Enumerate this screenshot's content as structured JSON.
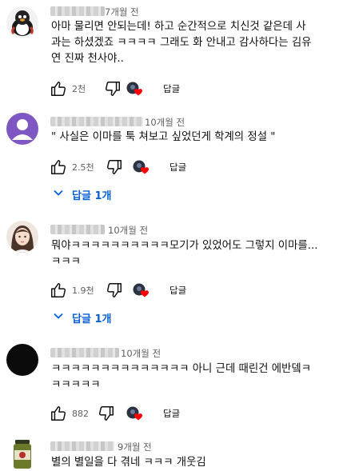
{
  "comments": [
    {
      "time": "7개월 전",
      "lines": [
        "아마 물리면 안되는데! 하고 순간적으로 치신것 같은데 사",
        "과는 하셨겠죠 ㅋㅋㅋㅋ 그래도 화 안내고 감사하다는 김유",
        "연 진짜 천사야.."
      ],
      "likes": "2천",
      "reply_label": "답글"
    },
    {
      "time": "10개월 전",
      "lines": [
        "\" 사실은 이마를 툭 쳐보고 싶었던게 학계의 정설 \""
      ],
      "likes": "2.5천",
      "reply_label": "답글",
      "replies_label": "답글 1개"
    },
    {
      "time": "10개월 전",
      "lines": [
        "뭐야ㅋㅋㅋㅋㅋㅋㅋㅋㅋㅋ모기가 있었어도 그렇지 이마를...",
        "ㅋㅋㅋ"
      ],
      "likes": "1.9천",
      "reply_label": "답글",
      "replies_label": "답글 1개"
    },
    {
      "time": "10개월 전",
      "lines": [
        "ㅋㅋㅋㅋㅋㅋㅋㅋㅋㅋㅋㅋㅋㅋ 아니 근데 때린건 에반뎈ㅋ",
        "ㅋㅋㅋㅋㅋ"
      ],
      "likes": "882",
      "reply_label": "답글"
    },
    {
      "time": "9개월 전",
      "lines": [
        "별의 별일을 다 겪네 ㅋㅋㅋ 개웃김"
      ]
    }
  ],
  "icons": {
    "like": "thumbs-up-icon",
    "dislike": "thumbs-down-icon",
    "creator_heart": "creator-heart-icon",
    "expand": "chevron-down-icon"
  },
  "colors": {
    "reply_link": "#065fd4",
    "heart": "#ff0000",
    "meta_text": "#606060"
  }
}
